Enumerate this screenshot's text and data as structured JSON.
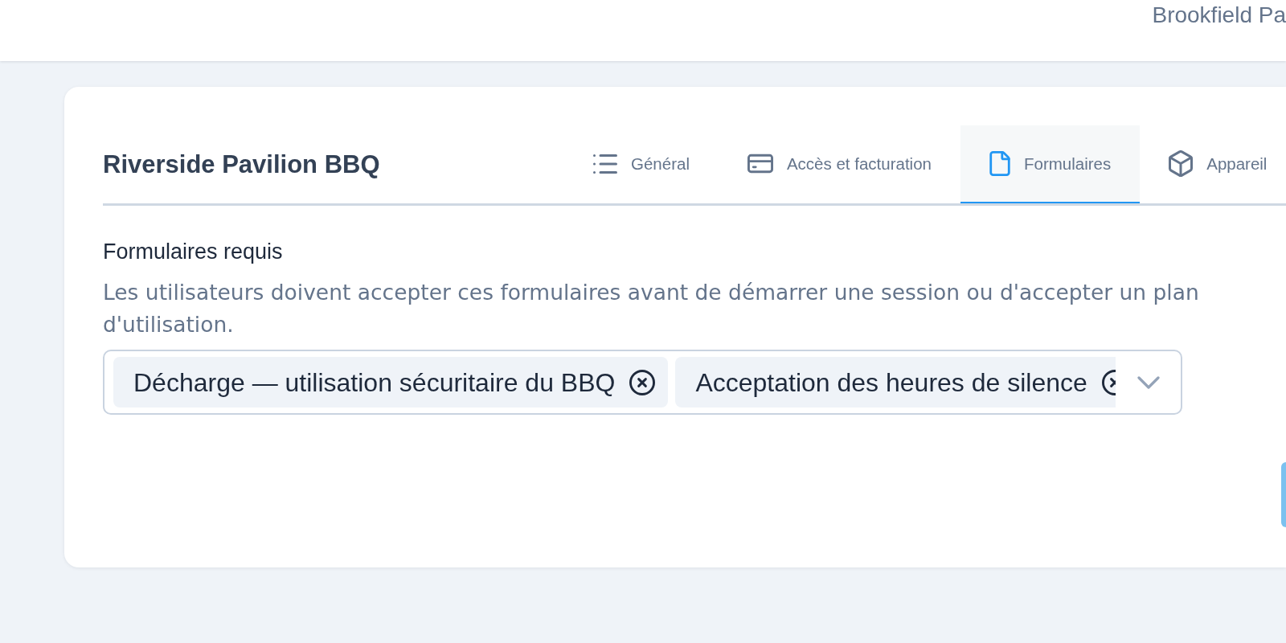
{
  "header": {
    "account_name": "Brookfield Pa"
  },
  "card": {
    "title": "Riverside Pavilion BBQ",
    "tabs": [
      {
        "label": "Général",
        "selected": false
      },
      {
        "label": "Accès et facturation",
        "selected": false
      },
      {
        "label": "Formulaires",
        "selected": true
      },
      {
        "label": "Appareil",
        "selected": false
      }
    ]
  },
  "required_forms": {
    "label": "Formulaires requis",
    "description": "Les utilisateurs doivent accepter ces formulaires avant de démarrer une session ou d'accepter un plan d'utilisation.",
    "selected_forms": [
      {
        "label": "Décharge — utilisation sécuritaire du BBQ"
      },
      {
        "label": "Acceptation des heures de silence"
      }
    ]
  }
}
